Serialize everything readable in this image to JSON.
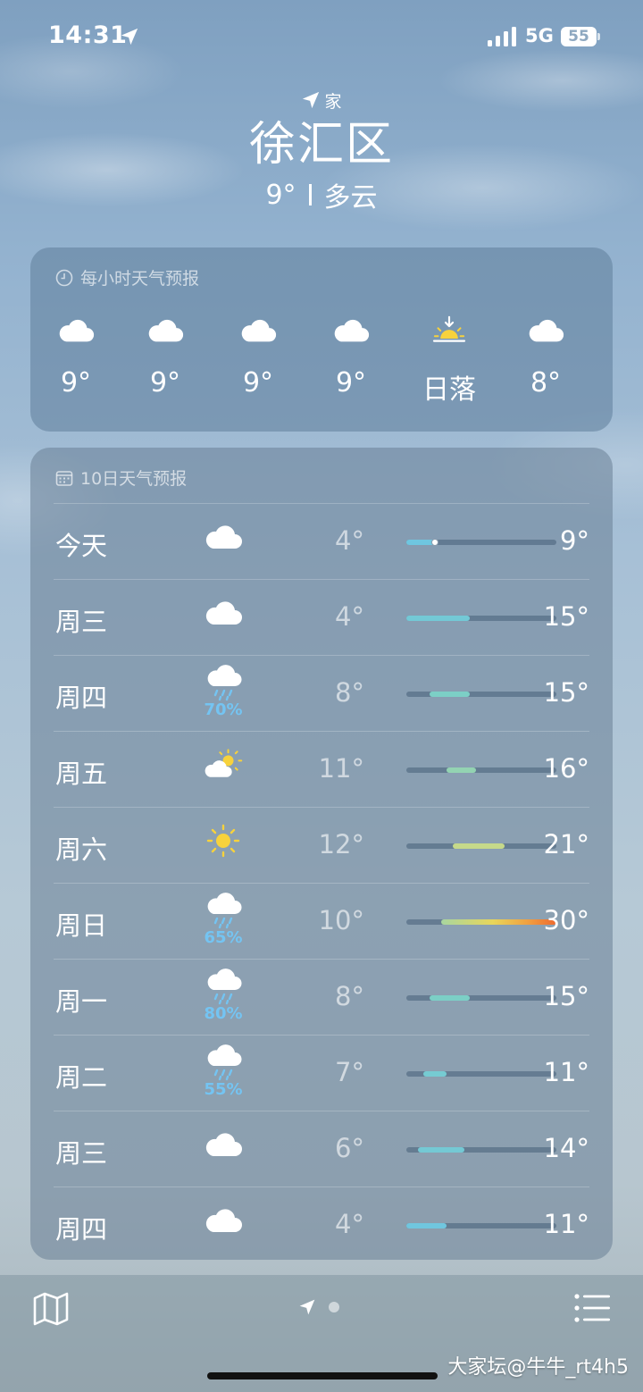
{
  "status_bar": {
    "time": "14:31",
    "network": "5G",
    "battery": "55"
  },
  "header": {
    "location_label": "家",
    "city": "徐汇区",
    "temperature": "9°",
    "condition": "多云"
  },
  "hourly_forecast": {
    "title": "每小时天气预报",
    "hours": [
      {
        "icon": "cloud-icon",
        "temp": "9°"
      },
      {
        "icon": "cloud-icon",
        "temp": "9°"
      },
      {
        "icon": "cloud-icon",
        "temp": "9°"
      },
      {
        "icon": "cloud-icon",
        "temp": "9°"
      },
      {
        "icon": "sunset-icon",
        "temp": "日落"
      },
      {
        "icon": "cloud-icon",
        "temp": "8°"
      }
    ]
  },
  "daily_forecast": {
    "title": "10日天气预报",
    "range_min": 4,
    "range_max": 30,
    "current_temp": 9,
    "days": [
      {
        "day": "今天",
        "icon": "cloud-icon",
        "precip": "",
        "low": "4°",
        "high": "9°",
        "low_value": 4,
        "high_value": 9,
        "color": "#6fc6e0"
      },
      {
        "day": "周三",
        "icon": "cloud-icon",
        "precip": "",
        "low": "4°",
        "high": "15°",
        "low_value": 4,
        "high_value": 15,
        "color": "#73c9d6"
      },
      {
        "day": "周四",
        "icon": "rain-cloud-icon",
        "precip": "70%",
        "low": "8°",
        "high": "15°",
        "low_value": 8,
        "high_value": 15,
        "color": "#7ccfc6"
      },
      {
        "day": "周五",
        "icon": "partly-sunny-icon",
        "precip": "",
        "low": "11°",
        "high": "16°",
        "low_value": 11,
        "high_value": 16,
        "color": "#93d3b2"
      },
      {
        "day": "周六",
        "icon": "sun-icon",
        "precip": "",
        "low": "12°",
        "high": "21°",
        "low_value": 12,
        "high_value": 21,
        "color": "#c6d98a"
      },
      {
        "day": "周日",
        "icon": "rain-cloud-icon",
        "precip": "65%",
        "low": "10°",
        "high": "30°",
        "low_value": 10,
        "high_value": 30,
        "color": "gradient"
      },
      {
        "day": "周一",
        "icon": "rain-cloud-icon",
        "precip": "80%",
        "low": "8°",
        "high": "15°",
        "low_value": 8,
        "high_value": 15,
        "color": "#7ccfc6"
      },
      {
        "day": "周二",
        "icon": "rain-cloud-icon",
        "precip": "55%",
        "low": "7°",
        "high": "11°",
        "low_value": 7,
        "high_value": 11,
        "color": "#76cbd2"
      },
      {
        "day": "周三",
        "icon": "cloud-icon",
        "precip": "",
        "low": "6°",
        "high": "14°",
        "low_value": 6,
        "high_value": 14,
        "color": "#74c9d4"
      },
      {
        "day": "周四",
        "icon": "cloud-icon",
        "precip": "",
        "low": "4°",
        "high": "11°",
        "low_value": 4,
        "high_value": 11,
        "color": "#70c6de"
      }
    ]
  },
  "bottom_bar": {
    "map_icon": "map-icon",
    "location_icon": "location-arrow-icon",
    "list_icon": "list-icon"
  },
  "watermark": "大家坛@牛牛_rt4h5"
}
